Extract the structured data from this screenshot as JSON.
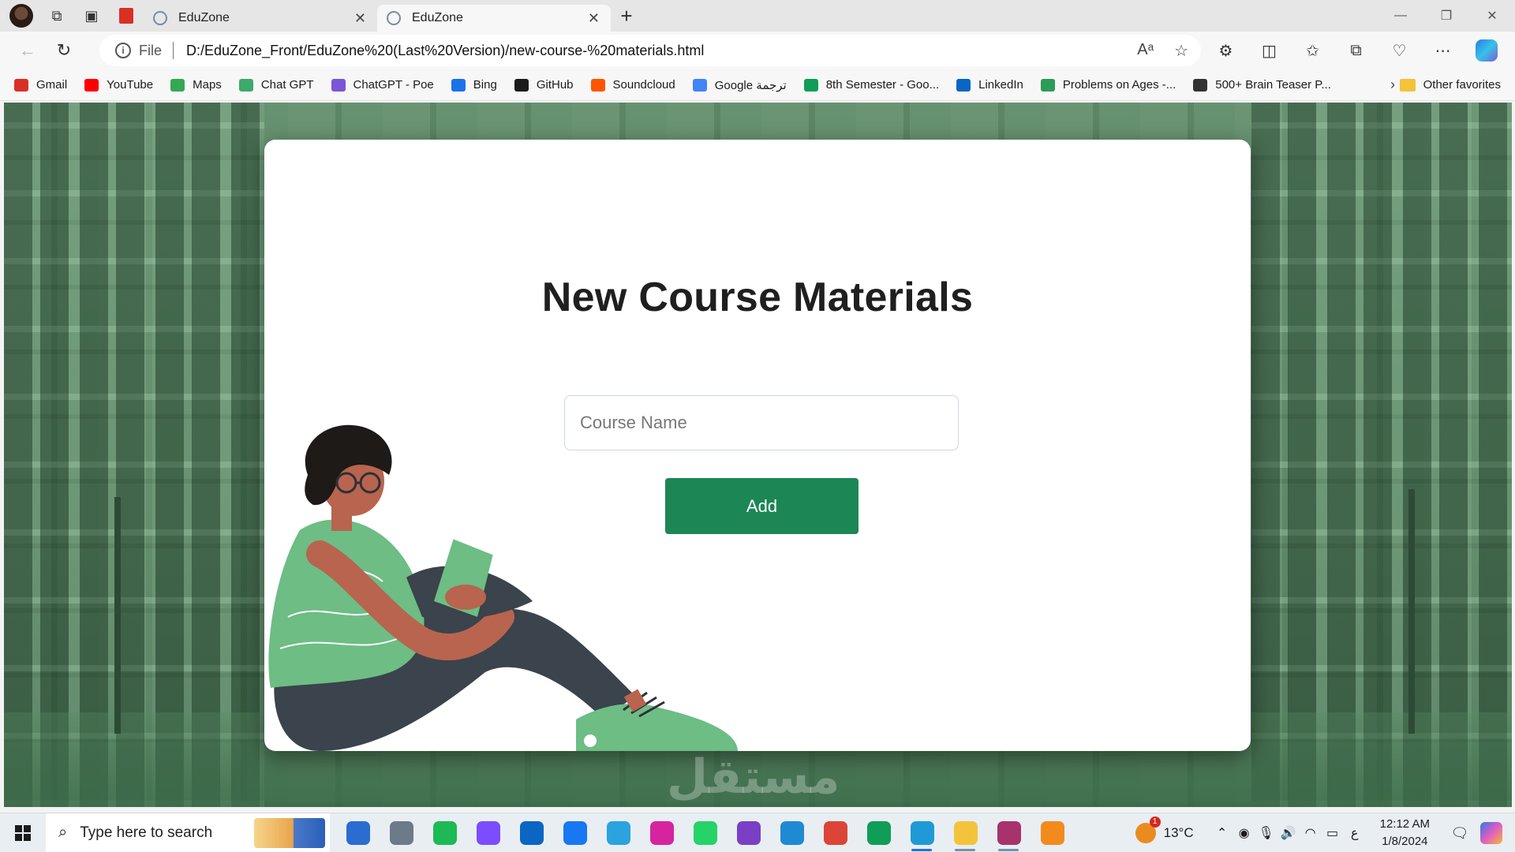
{
  "browser": {
    "tabs": [
      {
        "title": "EduZone",
        "active": false
      },
      {
        "title": "EduZone",
        "active": true
      }
    ],
    "address": {
      "scheme_label": "File",
      "url": "D:/EduZone_Front/EduZone%20(Last%20Version)/new-course-%20materials.html"
    },
    "favorites": [
      {
        "label": "Gmail",
        "color": "#d93025"
      },
      {
        "label": "YouTube",
        "color": "#ff0000"
      },
      {
        "label": "Maps",
        "color": "#34a853"
      },
      {
        "label": "Chat GPT",
        "color": "#3fa86b"
      },
      {
        "label": "ChatGPT - Poe",
        "color": "#7b56d8"
      },
      {
        "label": "Bing",
        "color": "#1a73e8"
      },
      {
        "label": "GitHub",
        "color": "#1b1b1b"
      },
      {
        "label": "Soundcloud",
        "color": "#ff5500"
      },
      {
        "label": "Google ترجمة",
        "color": "#4285f4"
      },
      {
        "label": "8th Semester - Goo...",
        "color": "#0f9d58"
      },
      {
        "label": "LinkedIn",
        "color": "#0a66c2"
      },
      {
        "label": "Problems on Ages -...",
        "color": "#2e9b56"
      },
      {
        "label": "500+ Brain Teaser P...",
        "color": "#333333"
      }
    ],
    "other_favorites": "Other favorites"
  },
  "page": {
    "title": "New Course Materials",
    "course_input": {
      "placeholder": "Course Name",
      "value": ""
    },
    "add_label": "Add",
    "watermark": "مستقل",
    "colors": {
      "accent": "#1d8655",
      "background_tint": "#4f7d59",
      "illustration_green": "#6dbd84",
      "illustration_dark": "#3b434c"
    }
  },
  "taskbar": {
    "search_placeholder": "Type here to search",
    "apps": [
      {
        "name": "microsoft-store-icon",
        "color": "#2b6cd1"
      },
      {
        "name": "calculator-icon",
        "color": "#6c7a89"
      },
      {
        "name": "spotify-icon",
        "color": "#1db954"
      },
      {
        "name": "messenger-icon",
        "color": "#7b4dff"
      },
      {
        "name": "linkedin-icon",
        "color": "#0a66c2"
      },
      {
        "name": "facebook-icon",
        "color": "#1877f2"
      },
      {
        "name": "telegram-icon",
        "color": "#2aa3df"
      },
      {
        "name": "instagram-icon",
        "color": "#d6249f"
      },
      {
        "name": "whatsapp-icon",
        "color": "#25d366"
      },
      {
        "name": "visual-studio-icon",
        "color": "#7a3fc4"
      },
      {
        "name": "vscode-icon",
        "color": "#1f8ad2"
      },
      {
        "name": "chrome-icon",
        "color": "#db4437"
      },
      {
        "name": "chrome-profile-icon",
        "color": "#0f9d58"
      },
      {
        "name": "edge-icon",
        "color": "#1f9ad6"
      },
      {
        "name": "file-explorer-icon",
        "color": "#f3c33c"
      },
      {
        "name": "winrar-icon",
        "color": "#a8326b"
      },
      {
        "name": "sublime-icon",
        "color": "#f28b1c"
      }
    ],
    "weather": "13°C",
    "language": "ع",
    "time": "12:12 AM",
    "date": "1/8/2024"
  }
}
